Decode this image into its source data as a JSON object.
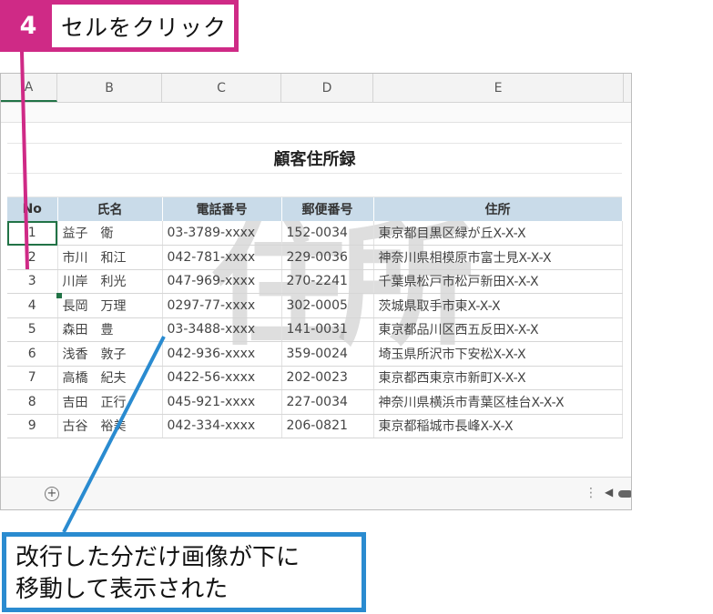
{
  "step": {
    "number": "4",
    "text": "セルをクリック"
  },
  "result_note": {
    "line1": "改行した分だけ画像が下に",
    "line2": "移動して表示された"
  },
  "sheet": {
    "columns": [
      "A",
      "B",
      "C",
      "D",
      "E"
    ],
    "title": "顧客住所録",
    "headers": [
      "No",
      "氏名",
      "電話番号",
      "郵便番号",
      "住所"
    ],
    "rows": [
      [
        "1",
        "益子　衛",
        "03-3789-xxxx",
        "152-0034",
        "東京都目黒区緑が丘X-X-X"
      ],
      [
        "2",
        "市川　和江",
        "042-781-xxxx",
        "229-0036",
        "神奈川県相模原市富士見X-X-X"
      ],
      [
        "3",
        "川岸　利光",
        "047-969-xxxx",
        "270-2241",
        "千葉県松戸市松戸新田X-X-X"
      ],
      [
        "4",
        "長岡　万理",
        "0297-77-xxxx",
        "302-0005",
        "茨城県取手市東X-X-X"
      ],
      [
        "5",
        "森田　豊",
        "03-3488-xxxx",
        "141-0031",
        "東京都品川区西五反田X-X-X"
      ],
      [
        "6",
        "浅香　敦子",
        "042-936-xxxx",
        "359-0024",
        "埼玉県所沢市下安松X-X-X"
      ],
      [
        "7",
        "高橋　紀夫",
        "0422-56-xxxx",
        "202-0023",
        "東京都西東京市新町X-X-X"
      ],
      [
        "8",
        "吉田　正行",
        "045-921-xxxx",
        "227-0034",
        "神奈川県横浜市青葉区桂台X-X-X"
      ],
      [
        "9",
        "古谷　裕美",
        "042-334-xxxx",
        "206-0821",
        "東京都稲城市長峰X-X-X"
      ]
    ],
    "watermark": "住所",
    "icons": {
      "add_sheet": "plus-circle-icon",
      "scroll_left": "triangle-left-icon"
    },
    "accent_color": "#217346",
    "step_color": "#cf2a86",
    "note_color": "#2a8bd0"
  }
}
